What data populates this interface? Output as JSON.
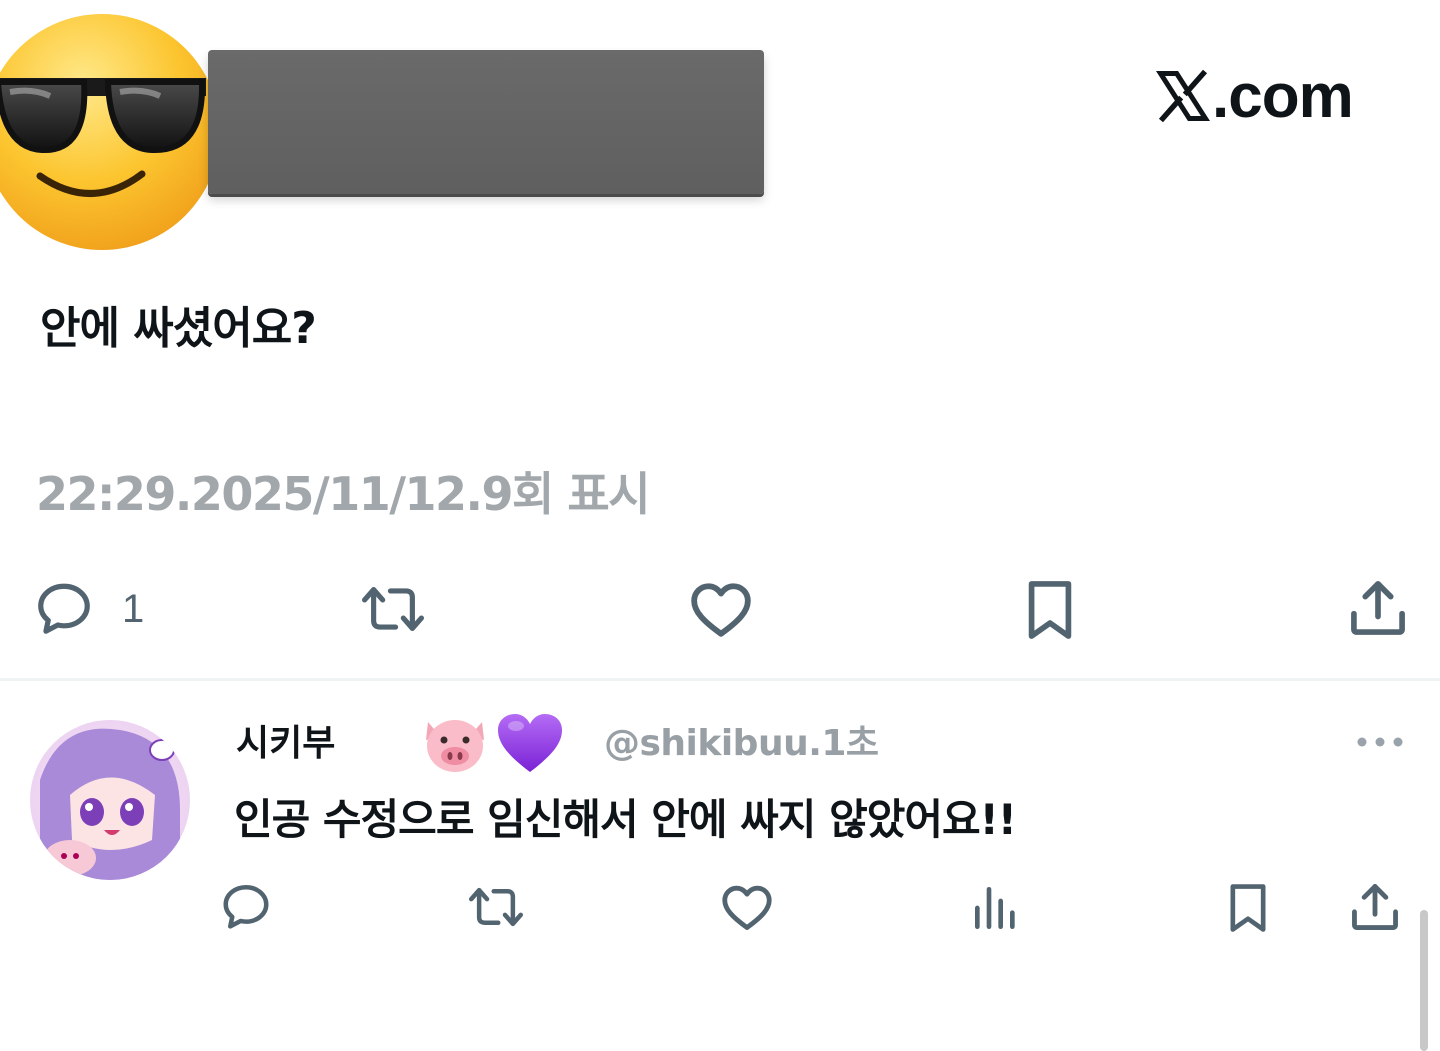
{
  "brand": {
    "logo_text": ".com",
    "logo_icon": "x-logo-icon"
  },
  "tweet": {
    "text": "안에 싸셨어요?",
    "meta": "22:29.2025/11/12.9회 표시",
    "reply_count": "1",
    "icons": [
      "reply-icon",
      "retweet-icon",
      "like-icon",
      "bookmark-icon",
      "share-icon"
    ]
  },
  "reply": {
    "name": "시키부",
    "handle_time": "@shikibuu.1초",
    "text": "인공 수정으로 임신해서 안에 싸지 않았어요!!",
    "badges": [
      "pig-emoji",
      "purple-heart-emoji"
    ],
    "icons": [
      "reply-icon",
      "retweet-icon",
      "like-icon",
      "views-icon",
      "bookmark-icon",
      "share-icon",
      "more-icon"
    ]
  },
  "colors": {
    "text": "#0f1419",
    "muted": "#536471",
    "meta": "#a2a7ab",
    "divider": "#eff3f4",
    "redaction": "#666666"
  }
}
